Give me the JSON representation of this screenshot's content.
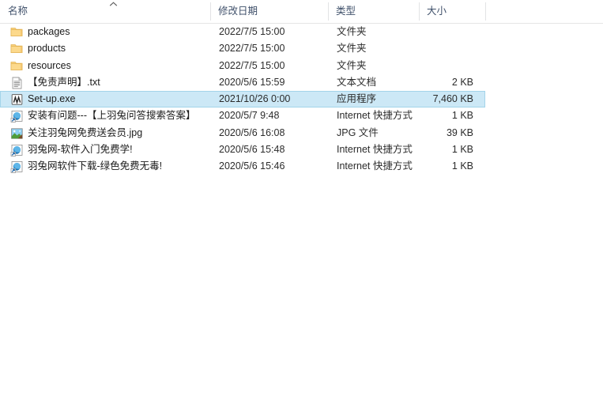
{
  "window": {
    "title": "File Explorer list view"
  },
  "columns": {
    "name": "名称",
    "date": "修改日期",
    "type": "类型",
    "size": "大小",
    "sort_indicator": "ascending-sort-arrow"
  },
  "colors": {
    "selection_fill": "#cce8f6",
    "selection_border": "#a3d4ea",
    "header_text": "#40516b",
    "row_text": "#1a1a1a",
    "divider": "#e2e3e5",
    "folder_icon": "#f7cb6a"
  },
  "rows": [
    {
      "name": "packages",
      "date": "2022/7/5 15:00",
      "type": "文件夹",
      "size": "",
      "icon": "folder-icon",
      "selected": false
    },
    {
      "name": "products",
      "date": "2022/7/5 15:00",
      "type": "文件夹",
      "size": "",
      "icon": "folder-icon",
      "selected": false
    },
    {
      "name": "resources",
      "date": "2022/7/5 15:00",
      "type": "文件夹",
      "size": "",
      "icon": "folder-icon",
      "selected": false
    },
    {
      "name": "【免责声明】.txt",
      "date": "2020/5/6 15:59",
      "type": "文本文档",
      "size": "2 KB",
      "icon": "text-document-icon",
      "selected": false
    },
    {
      "name": "Set-up.exe",
      "date": "2021/10/26 0:00",
      "type": "应用程序",
      "size": "7,460 KB",
      "icon": "application-icon",
      "selected": true
    },
    {
      "name": "安装有问题---【上羽兔问答搜索答案】",
      "date": "2020/5/7 9:48",
      "type": "Internet 快捷方式",
      "size": "1 KB",
      "icon": "internet-shortcut-icon",
      "selected": false
    },
    {
      "name": "关注羽兔网免费送会员.jpg",
      "date": "2020/5/6 16:08",
      "type": "JPG 文件",
      "size": "39 KB",
      "icon": "jpg-image-icon",
      "selected": false
    },
    {
      "name": "羽兔网-软件入门免费学!",
      "date": "2020/5/6 15:48",
      "type": "Internet 快捷方式",
      "size": "1 KB",
      "icon": "internet-shortcut-icon",
      "selected": false
    },
    {
      "name": "羽兔网软件下载-绿色免费无毒!",
      "date": "2020/5/6 15:46",
      "type": "Internet 快捷方式",
      "size": "1 KB",
      "icon": "internet-shortcut-icon",
      "selected": false
    }
  ]
}
